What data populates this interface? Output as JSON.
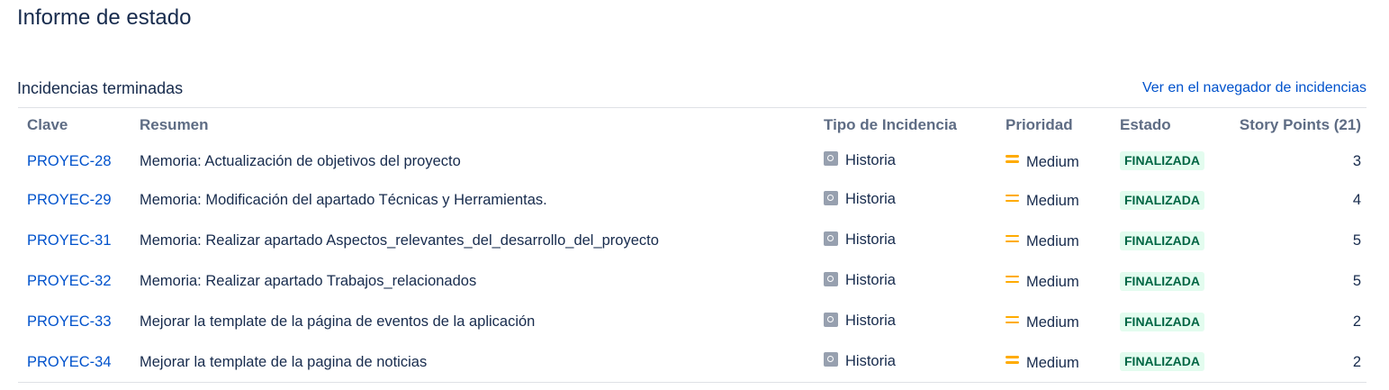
{
  "page": {
    "title": "Informe de estado"
  },
  "section": {
    "title": "Incidencias terminadas",
    "nav_link": "Ver en el navegador de incidencias"
  },
  "table": {
    "headers": {
      "key": "Clave",
      "summary": "Resumen",
      "type": "Tipo de Incidencia",
      "priority": "Prioridad",
      "status": "Estado",
      "story_points": "Story Points (21)"
    },
    "icons": {
      "type": "story-icon",
      "priority": "priority-medium-icon"
    },
    "colors": {
      "link": "#0052cc",
      "priority_medium": "#ffab00",
      "status_bg": "#e3fcef",
      "status_text": "#006644"
    },
    "rows": [
      {
        "key": "PROYEC-28",
        "summary": "Memoria: Actualización de objetivos del proyecto",
        "type": "Historia",
        "priority": "Medium",
        "status": "FINALIZADA",
        "story_points": "3"
      },
      {
        "key": "PROYEC-29",
        "summary": "Memoria: Modificación del apartado Técnicas y Herramientas.",
        "type": "Historia",
        "priority": "Medium",
        "status": "FINALIZADA",
        "story_points": "4"
      },
      {
        "key": "PROYEC-31",
        "summary": "Memoria: Realizar apartado Aspectos_relevantes_del_desarrollo_del_proyecto",
        "type": "Historia",
        "priority": "Medium",
        "status": "FINALIZADA",
        "story_points": "5"
      },
      {
        "key": "PROYEC-32",
        "summary": "Memoria: Realizar apartado Trabajos_relacionados",
        "type": "Historia",
        "priority": "Medium",
        "status": "FINALIZADA",
        "story_points": "5"
      },
      {
        "key": "PROYEC-33",
        "summary": "Mejorar la template de la página de eventos de la aplicación",
        "type": "Historia",
        "priority": "Medium",
        "status": "FINALIZADA",
        "story_points": "2"
      },
      {
        "key": "PROYEC-34",
        "summary": "Mejorar la template de la pagina de noticias",
        "type": "Historia",
        "priority": "Medium",
        "status": "FINALIZADA",
        "story_points": "2"
      }
    ]
  }
}
